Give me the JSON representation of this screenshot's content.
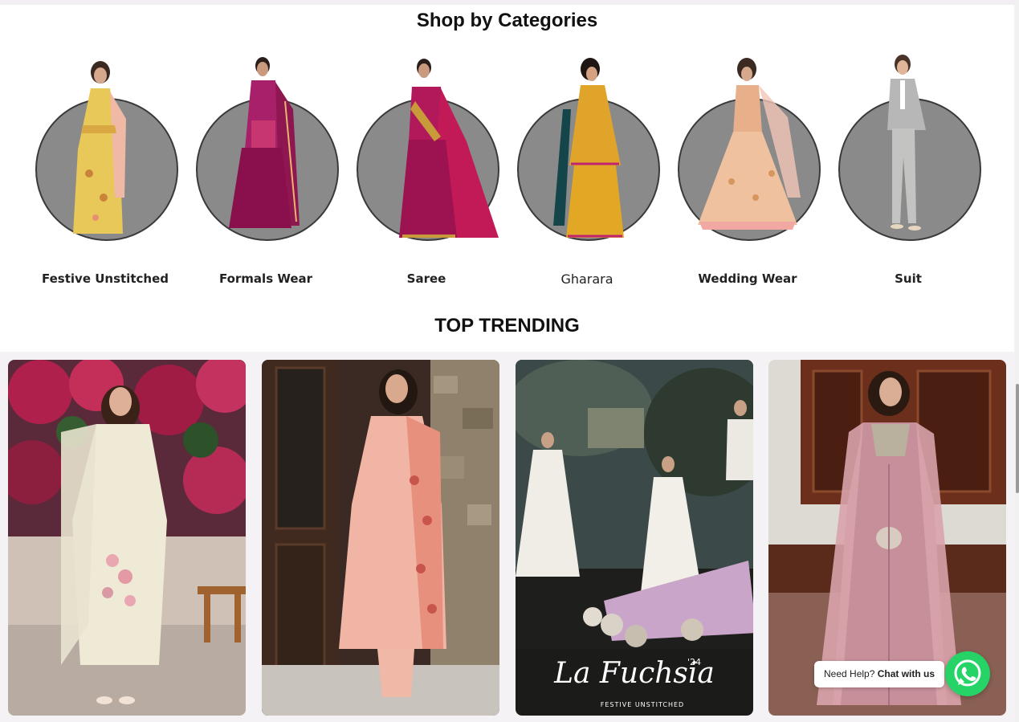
{
  "categories_section": {
    "title": "Shop by Categories",
    "items": [
      {
        "label": "Festive Unstitched"
      },
      {
        "label": "Formals Wear"
      },
      {
        "label": "Saree"
      },
      {
        "label": "Gharara"
      },
      {
        "label": "Wedding Wear"
      },
      {
        "label": "Suit"
      }
    ]
  },
  "trending_section": {
    "title": "TOP TRENDING",
    "cards": [
      {
        "overlay_title": "",
        "overlay_subtitle": ""
      },
      {
        "overlay_title": "",
        "overlay_subtitle": ""
      },
      {
        "overlay_title": "La Fuchsia",
        "overlay_sup": "'24",
        "overlay_subtitle": "FESTIVE UNSTITCHED"
      },
      {
        "overlay_title": "",
        "overlay_subtitle": ""
      }
    ]
  },
  "chat_widget": {
    "prefix": "Need Help?",
    "link": "Chat with us",
    "icon": "whatsapp-icon",
    "color": "#25d366"
  }
}
